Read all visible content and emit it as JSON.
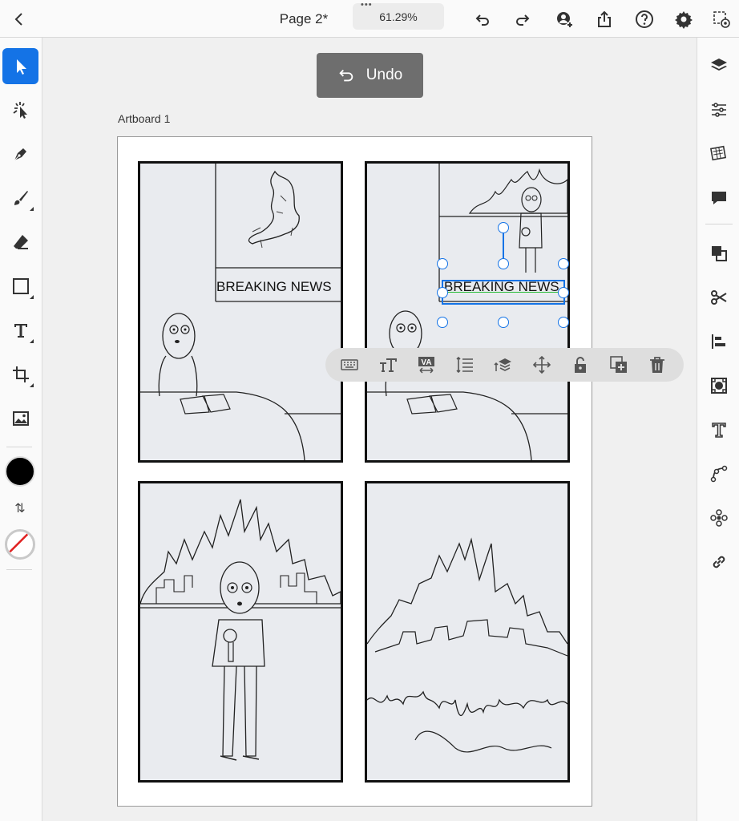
{
  "topbar": {
    "back_icon": "chevron-left-icon",
    "document_title": "Page 2*",
    "zoom": "61.29%",
    "actions": [
      "undo-icon",
      "redo-icon",
      "invite-icon",
      "share-icon",
      "help-icon",
      "settings-icon",
      "preview-icon"
    ]
  },
  "undo_toast": {
    "label": "Undo"
  },
  "artboard": {
    "label": "Artboard 1"
  },
  "panels": {
    "panel1_text": "BREAKING NEWS",
    "panel2_text": "BREAKING NEWS"
  },
  "left_tools": [
    "select-tool",
    "magic-wand-tool",
    "pen-tool",
    "brush-tool",
    "eraser-tool",
    "rectangle-tool",
    "type-tool",
    "crop-tool",
    "image-tool"
  ],
  "colors": {
    "fill": "#000000",
    "accent": "#1473e6",
    "stroke": "none"
  },
  "right_panels": [
    "layers",
    "properties",
    "libraries",
    "comments",
    "arrange",
    "scissors",
    "align",
    "repeat-grid",
    "text-on-path",
    "path",
    "plugins",
    "links"
  ],
  "context_toolbar": [
    "keyboard",
    "text-size",
    "character-spacing",
    "line-spacing",
    "arrange",
    "move",
    "lock",
    "duplicate",
    "delete"
  ]
}
